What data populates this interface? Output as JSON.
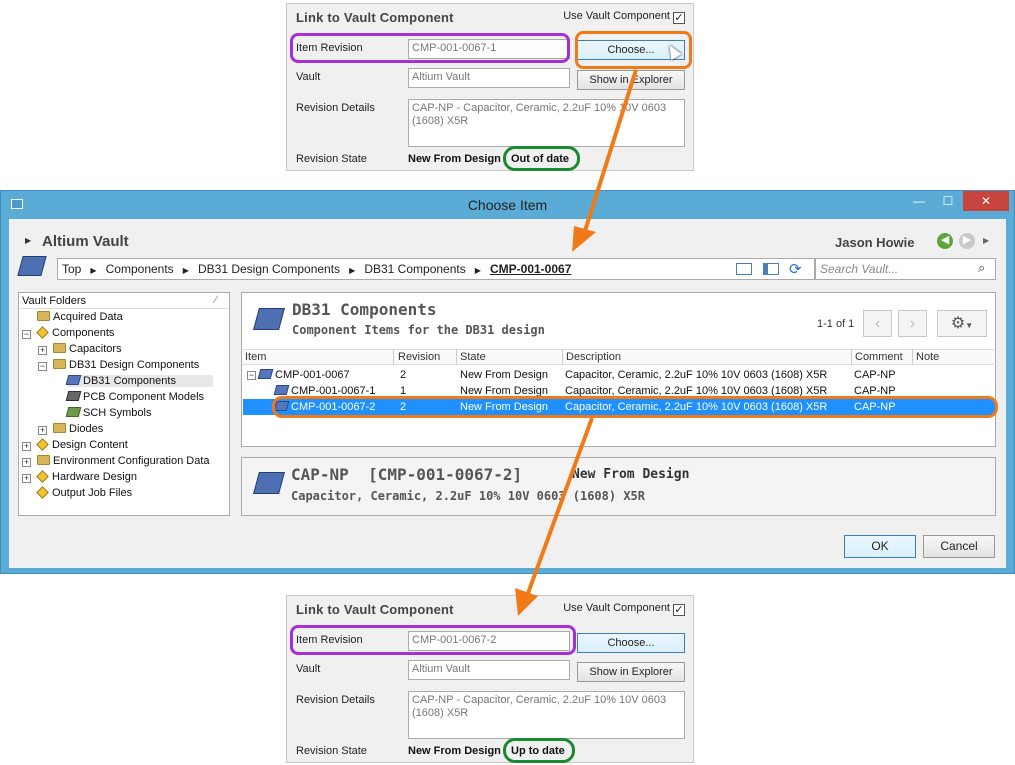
{
  "top_panel": {
    "title": "Link to Vault Component",
    "use_vault_label": "Use Vault Component",
    "item_revision_label": "Item Revision",
    "item_revision_value": "CMP-001-0067-1",
    "choose_label": "Choose...",
    "vault_label": "Vault",
    "vault_value": "Altium Vault",
    "explorer_label": "Show in Explorer",
    "details_label": "Revision Details",
    "details_value": "CAP-NP - Capacitor, Ceramic, 2.2uF 10% 10V 0603 (1608) X5R",
    "state_label": "Revision State",
    "state_value": "New From Design",
    "state_status": "Out of date"
  },
  "dialog": {
    "title": "Choose Item",
    "vault_name": "Altium Vault",
    "user": "Jason Howie",
    "breadcrumb": [
      "Top",
      "Components",
      "DB31 Design Components",
      "DB31 Components",
      "CMP-001-0067"
    ],
    "search_placeholder": "Search Vault...",
    "folders_header": "Vault Folders",
    "tree": [
      "Acquired Data",
      "Components",
      "Capacitors",
      "DB31 Design Components",
      "DB31 Components",
      "PCB Component Models",
      "SCH Symbols",
      "Diodes",
      "Design Content",
      "Environment Configuration Data",
      "Hardware Design",
      "Output Job Files"
    ],
    "folder_title": "DB31 Components",
    "folder_subtitle": "Component Items for the DB31 design",
    "paging": "1-1 of 1",
    "columns": [
      "Item",
      "Revision",
      "State",
      "Description",
      "Comment",
      "Note"
    ],
    "rows": [
      {
        "item": "CMP-001-0067",
        "revision": "2",
        "state": "New From Design",
        "description": "Capacitor, Ceramic, 2.2uF 10% 10V 0603 (1608) X5R",
        "comment": "CAP-NP"
      },
      {
        "item": "CMP-001-0067-1",
        "revision": "1",
        "state": "New From Design",
        "description": "Capacitor, Ceramic, 2.2uF 10% 10V 0603 (1608) X5R",
        "comment": "CAP-NP"
      },
      {
        "item": "CMP-001-0067-2",
        "revision": "2",
        "state": "New From Design",
        "description": "Capacitor, Ceramic, 2.2uF 10% 10V 0603 (1608) X5R",
        "comment": "CAP-NP"
      }
    ],
    "detail_title": "CAP-NP  [CMP-001-0067-2]",
    "detail_state": "New From Design",
    "detail_desc": "Capacitor, Ceramic, 2.2uF 10% 10V 0603 (1608) X5R",
    "ok": "OK",
    "cancel": "Cancel"
  },
  "bottom_panel": {
    "title": "Link to Vault Component",
    "use_vault_label": "Use Vault Component",
    "item_revision_label": "Item Revision",
    "item_revision_value": "CMP-001-0067-2",
    "choose_label": "Choose...",
    "vault_label": "Vault",
    "vault_value": "Altium Vault",
    "explorer_label": "Show in Explorer",
    "details_label": "Revision Details",
    "details_value": "CAP-NP - Capacitor, Ceramic, 2.2uF 10% 10V 0603 (1608) X5R",
    "state_label": "Revision State",
    "state_value": "New From Design",
    "state_status": "Up to date"
  },
  "colors": {
    "purple": "#a62fd8",
    "orange": "#f07a18",
    "green": "#1a8a2e",
    "selection": "#1e90ff"
  }
}
